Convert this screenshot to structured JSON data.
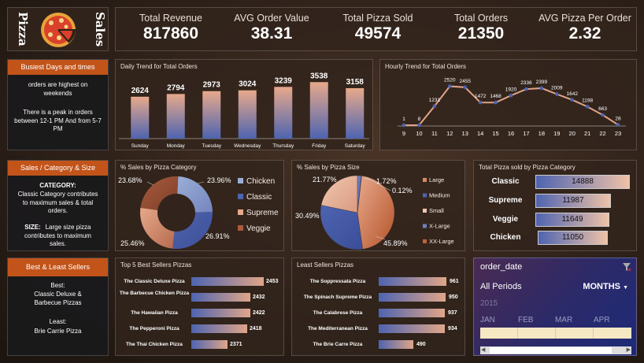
{
  "logo": {
    "word1": "Pizza",
    "word2": "Sales"
  },
  "kpis": [
    {
      "label": "Total Revenue",
      "value": "817860"
    },
    {
      "label": "AVG Order Value",
      "value": "38.31"
    },
    {
      "label": "Total Pizza Sold",
      "value": "49574"
    },
    {
      "label": "Total Orders",
      "value": "21350"
    },
    {
      "label": "AVG Pizza Per Order",
      "value": "2.32"
    }
  ],
  "busiest": {
    "title": "Busiest Days and times",
    "line1": "orders are highest on weekends",
    "line2": "There is a peak in orders between 12-1 PM And from 5-7 PM"
  },
  "salescat": {
    "title": "Sales / Category & Size",
    "h1": "CATEGORY:",
    "t1": "Classic Category contributes to maximum sales & total orders.",
    "h2": "SIZE:",
    "t2": "Large size pizza contributes to maximum sales."
  },
  "bestleast": {
    "title": "Best & Least Sellers",
    "h1": "Best:",
    "t1": "Classic Deluxe & Barbecue Pizzas",
    "h2": "Least:",
    "t2": "Brie Carrie Pizza"
  },
  "daily": {
    "title": "Daily Trend for Total Orders"
  },
  "hourly": {
    "title": "Hourly Trend for Total Orders"
  },
  "pcat": {
    "title": "% Sales by Pizza Category"
  },
  "psize": {
    "title": "% Sales by Pizza Size"
  },
  "catsold": {
    "title": "Total Pizza sold by Pizza Category",
    "rows": [
      {
        "label": "Classic",
        "value": "14888"
      },
      {
        "label": "Supreme",
        "value": "11987"
      },
      {
        "label": "Veggie",
        "value": "11649"
      },
      {
        "label": "Chicken",
        "value": "11050"
      }
    ]
  },
  "top5": {
    "title": "Top 5 Best Sellers Pizzas",
    "rows": [
      {
        "label": "The Classic Deluxe Pizza",
        "value": "2453"
      },
      {
        "label": "The Barbecue Chicken Pizza",
        "value": "2432"
      },
      {
        "label": "The Hawaiian Pizza",
        "value": "2422"
      },
      {
        "label": "The Pepperoni Pizza",
        "value": "2418"
      },
      {
        "label": "The Thai Chicken Pizza",
        "value": "2371"
      }
    ]
  },
  "least5": {
    "title": "Least Sellers Pizzas",
    "rows": [
      {
        "label": "The Soppressata Pizza",
        "value": "961"
      },
      {
        "label": "The Spinach Supreme Pizza",
        "value": "950"
      },
      {
        "label": "The Calabrese Pizza",
        "value": "937"
      },
      {
        "label": "The Mediterranean Pizza",
        "value": "934"
      },
      {
        "label": "The Brie Carre Pizza",
        "value": "490"
      }
    ]
  },
  "timeline": {
    "title": "order_date",
    "period": "All Periods",
    "unit": "MONTHS",
    "year": "2015",
    "months": [
      "JAN",
      "FEB",
      "MAR",
      "APR"
    ]
  },
  "chart_data": [
    {
      "type": "bar",
      "title": "Daily Trend for Total Orders",
      "categories": [
        "Sunday",
        "Monday",
        "Tuesday",
        "Wednesday",
        "Thursday",
        "Friday",
        "Saturday"
      ],
      "values": [
        2624,
        2794,
        2973,
        3024,
        3239,
        3538,
        3158
      ]
    },
    {
      "type": "line",
      "title": "Hourly Trend for Total Orders",
      "x": [
        9,
        10,
        11,
        12,
        13,
        14,
        15,
        16,
        17,
        18,
        19,
        20,
        21,
        22,
        23
      ],
      "values": [
        1,
        8,
        1231,
        2520,
        2455,
        1472,
        1468,
        1920,
        2336,
        2399,
        2009,
        1642,
        1198,
        663,
        28
      ]
    },
    {
      "type": "pie",
      "title": "% Sales by Pizza Category",
      "categories": [
        "Chicken",
        "Classic",
        "Supreme",
        "Veggie"
      ],
      "labels": [
        "23.96%",
        "26.91%",
        "25.46%",
        "23.68%"
      ],
      "values": [
        23.96,
        26.91,
        25.46,
        23.68
      ]
    },
    {
      "type": "pie",
      "title": "% Sales by Pizza Size",
      "categories": [
        "Large",
        "Medium",
        "Small",
        "X-Large",
        "XX-Large"
      ],
      "labels": [
        "45.89%",
        "30.49%",
        "21.77%",
        "1.72%",
        "0.12%"
      ],
      "values": [
        45.89,
        30.49,
        21.77,
        1.72,
        0.12
      ]
    }
  ],
  "colors": {
    "accent": "#c2541a",
    "blue": "#4e64b0",
    "peach": "#e0a589"
  }
}
